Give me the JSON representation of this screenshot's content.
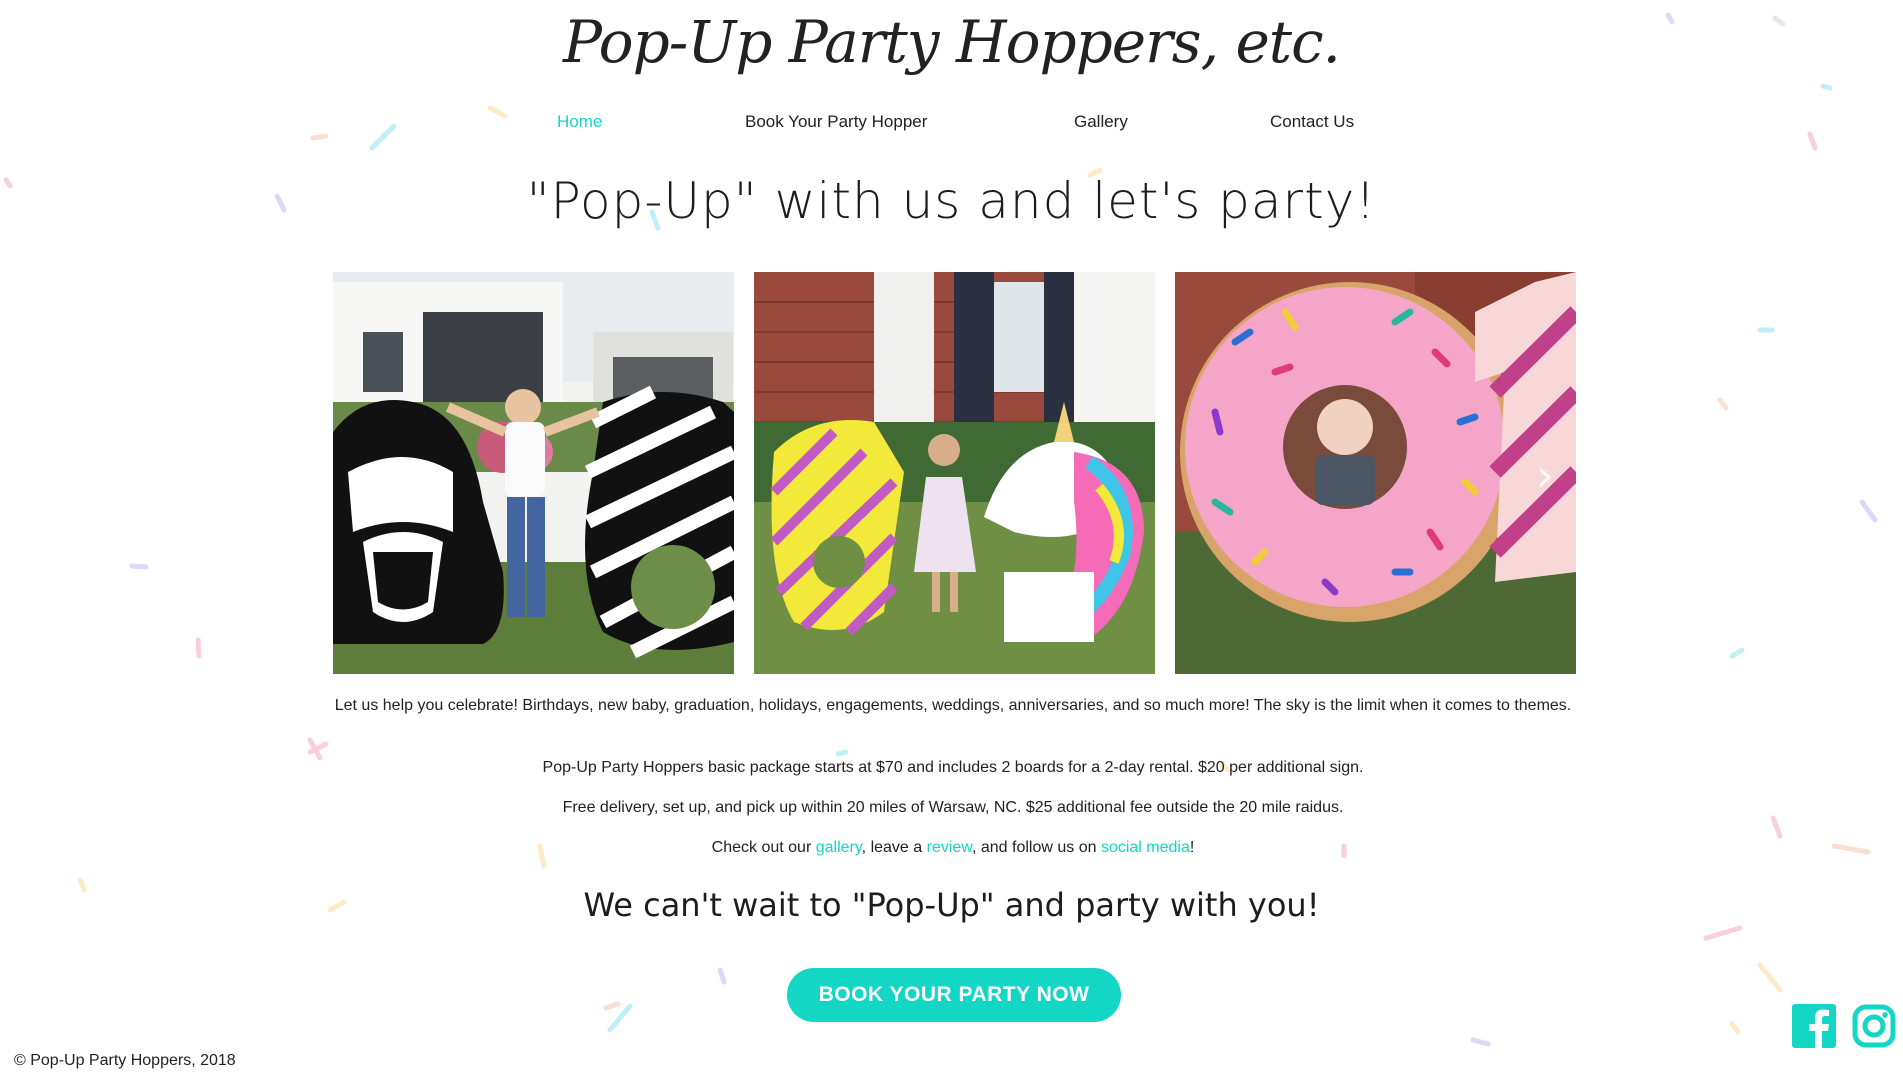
{
  "site": {
    "logo_text": "Pop-Up Party Hoppers, etc.",
    "accent_color": "#13d6c4"
  },
  "nav": {
    "items": [
      {
        "label": "Home",
        "active": true
      },
      {
        "label": "Book Your Party Hopper",
        "active": false
      },
      {
        "label": "Gallery",
        "active": false
      },
      {
        "label": "Contact Us",
        "active": false
      }
    ]
  },
  "hero": {
    "headline": "\"Pop-Up\" with us and let's party!"
  },
  "gallery": {
    "photos": [
      {
        "subject": "Darth Vader and striped 6 yard signs with boy"
      },
      {
        "subject": "Striped 6 and unicorn yard signs with girl"
      },
      {
        "subject": "Pink sprinkle donut 0 and striped 1 yard signs with baby"
      }
    ],
    "prev_icon": "chevron-left-icon",
    "next_icon": "chevron-right-icon"
  },
  "content": {
    "p1": "Let us help you celebrate! Birthdays, new baby, graduation, holidays, engagements, weddings, anniversaries, and so much more! The sky is the limit when it comes to themes.",
    "p2": "Pop-Up Party Hoppers basic package starts at $70 and includes 2 boards for a 2-day rental. $20 per additional sign.",
    "p3": "Free delivery, set up, and pick up within 20 miles of Warsaw, NC. $25 additional fee outside the 20 mile raidus.",
    "p4": {
      "part1": "Check out our ",
      "link_gallery": "gallery",
      "part2": ", leave a ",
      "link_review": "review",
      "part3": ", and follow us on ",
      "link_social": "social media",
      "part4": "!"
    },
    "subheadline": "We can't wait to \"Pop-Up\" and party with you!"
  },
  "cta": {
    "label": "BOOK YOUR PARTY NOW"
  },
  "footer": {
    "copyright": "© Pop-Up Party Hoppers, 2018"
  },
  "social": {
    "facebook_icon": "facebook-icon",
    "instagram_icon": "instagram-icon"
  }
}
